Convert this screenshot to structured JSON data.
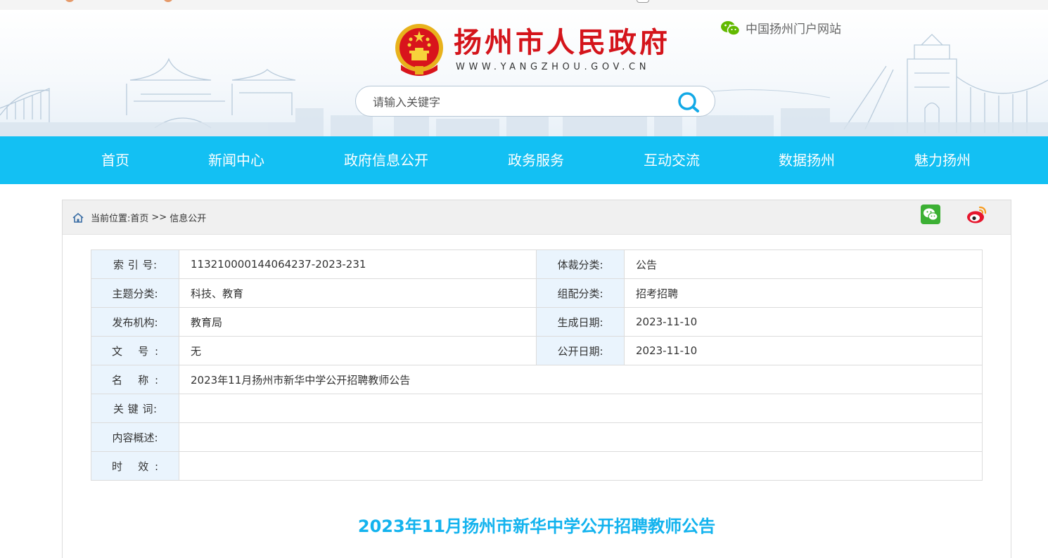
{
  "header": {
    "site_title": "扬州市人民政府",
    "site_url": "WWW.YANGZHOU.GOV.CN",
    "portal_link": "中国扬州门户网站",
    "search_placeholder": "请输入关键字"
  },
  "nav": [
    "首页",
    "新闻中心",
    "政府信息公开",
    "政务服务",
    "互动交流",
    "数据扬州",
    "魅力扬州"
  ],
  "breadcrumb": {
    "prefix": "当前位置:",
    "items": [
      "首页",
      "信息公开"
    ],
    "separator": ">>"
  },
  "meta": {
    "index_no_label": "索 引 号:",
    "index_no": "113210000144064237-2023-231",
    "genre_label": "体裁分类:",
    "genre": "公告",
    "topic_label": "主题分类:",
    "topic": "科技、教育",
    "config_label": "组配分类:",
    "config": "招考招聘",
    "publisher_label": "发布机构:",
    "publisher": "教育局",
    "created_label": "生成日期:",
    "created": "2023-11-10",
    "doc_no_label": "文 号:",
    "doc_no": "无",
    "published_label": "公开日期:",
    "published": "2023-11-10",
    "name_label": "名 称:",
    "name": "2023年11月扬州市新华中学公开招聘教师公告",
    "keywords_label": "关 键 词:",
    "keywords": "",
    "summary_label": "内容概述:",
    "summary": "",
    "validity_label": "时 效:",
    "validity": ""
  },
  "article": {
    "title": "2023年11月扬州市新华中学公开招聘教师公告"
  },
  "colors": {
    "nav_bg": "#13c0f3",
    "title_red": "#d4141b",
    "article_title": "#13b3ee",
    "label_bg": "#eaf4fd"
  },
  "icons": [
    "wechat-icon",
    "search-icon",
    "home-icon",
    "weibo-icon",
    "national-emblem-icon"
  ]
}
